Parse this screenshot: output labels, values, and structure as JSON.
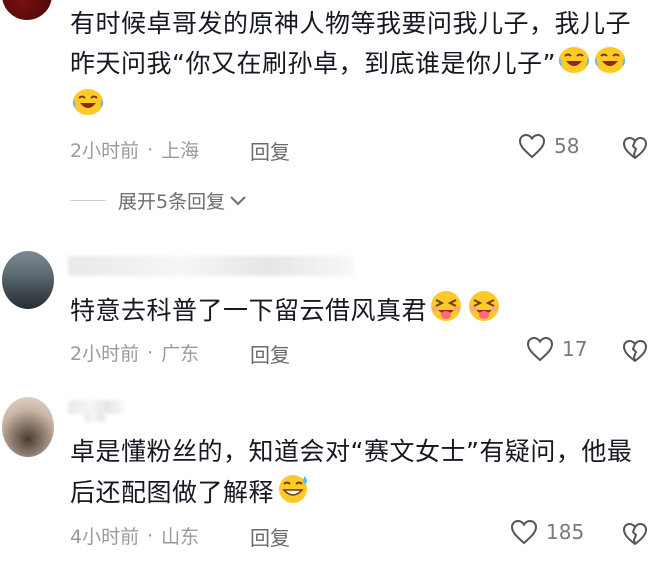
{
  "comments": [
    {
      "text_line1": "有时候卓哥发的原神人物等我要问我儿子，我儿子",
      "text_line2": "昨天问我“你又在刷孙卓，到底谁是你儿子”",
      "emoji_name": "laugh-cry-emoji",
      "time": "2小时前",
      "location": "上海",
      "reply_label": "回复",
      "likes": "58"
    },
    {
      "text_line1": "特意去科普了一下留云借风真君",
      "emoji_name": "wink-tongue-emoji",
      "time": "2小时前",
      "location": "广东",
      "reply_label": "回复",
      "likes": "17"
    },
    {
      "text_line1": "卓是懂粉丝的，知道会对“赛文女士”有疑问，他最",
      "text_line2": "后还配图做了解释",
      "emoji_name": "grin-sweat-emoji",
      "time": "4小时前",
      "location": "山东",
      "reply_label": "回复",
      "likes": "185"
    }
  ],
  "expand_replies": "展开5条回复",
  "icons": {
    "heart": "heart-outline-icon",
    "broken_heart": "broken-heart-icon",
    "chevron": "chevron-down-icon"
  },
  "colors": {
    "text": "#161823",
    "meta": "#9a9a9a",
    "emoji_face": "#ffc928"
  }
}
